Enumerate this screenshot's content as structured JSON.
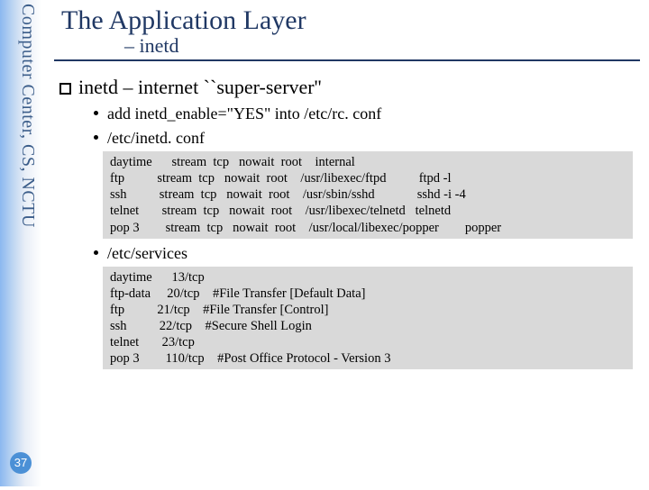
{
  "sidebar": {
    "org": "Computer Center, CS, NCTU"
  },
  "page": {
    "number": "37"
  },
  "title": "The Application Layer",
  "subtitle": "– inetd",
  "heading": "inetd – internet ``super-server''",
  "bullets": {
    "b1": "add inetd_enable=\"YES\" into /etc/rc. conf",
    "b2": "/etc/inetd. conf",
    "b3": "/etc/services"
  },
  "code1": "daytime      stream  tcp   nowait  root    internal\nftp          stream  tcp   nowait  root    /usr/libexec/ftpd          ftpd -l\nssh          stream  tcp   nowait  root    /usr/sbin/sshd             sshd -i -4\ntelnet       stream  tcp   nowait  root    /usr/libexec/telnetd   telnetd\npop 3        stream  tcp   nowait  root    /usr/local/libexec/popper        popper",
  "code2": "daytime      13/tcp\nftp-data     20/tcp    #File Transfer [Default Data]\nftp          21/tcp    #File Transfer [Control]\nssh          22/tcp    #Secure Shell Login\ntelnet       23/tcp\npop 3        110/tcp    #Post Office Protocol - Version 3"
}
